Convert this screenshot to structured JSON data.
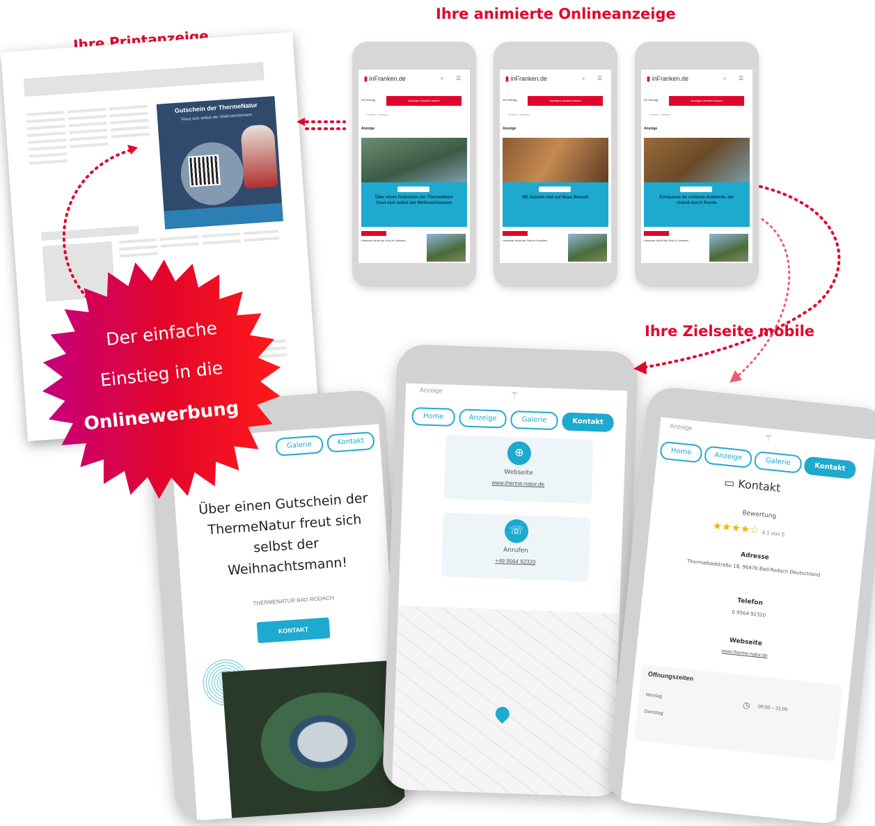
{
  "headings": {
    "print": "Ihre Printanzeige",
    "online": "Ihre animierte Onlineanzeige",
    "target": "Ihre Zielseite mobile"
  },
  "burst": {
    "line1": "Der einfache",
    "line2": "Einstieg in die",
    "line3": "Onlinewerbung"
  },
  "print_ad": {
    "title": "Gutschein der ThermeNatur",
    "subtitle": "Freut sich selbst der Weihnachtsmann"
  },
  "small_phone": {
    "logo": "inFranken",
    "logo_suffix": ".de",
    "anzeige": "Anzeige",
    "red_button": "Anzeigen schalten lassen",
    "tag": "28 Feiertag",
    "crumb": "Photos  ›  Sitemap",
    "news_text": "Hirschwe-Wuld mit Geld in Schutten",
    "ads": [
      {
        "text": "Über einen Gutschein der ThermeNatur freut sich selbst der Weihnachtsmann"
      },
      {
        "text": "Mit Saunen und auf Maas Besuch"
      },
      {
        "text": "Entspanne im schönen Ambiente, der eiskalt durch Runde"
      }
    ]
  },
  "left_phone": {
    "nav": [
      "Galerie",
      "Kontakt"
    ],
    "headline": "Über einen Gutschein der ThermeNatur freut sich selbst der Weihnachtsmann!",
    "subline": "THERMENATUR BAD RODACH",
    "button": "KONTAKT"
  },
  "middle_phone": {
    "anzeige": "Anzeige",
    "nav": [
      "Home",
      "Anzeige",
      "Galerie",
      "Kontakt"
    ],
    "website_label": "Webseite",
    "website_url": "www.therme-natur.de",
    "call_label": "Anrufen",
    "call_number": "+49 9564 92320"
  },
  "right_phone": {
    "anzeige": "Anzeige",
    "nav": [
      "Home",
      "Anzeige",
      "Galerie",
      "Kontakt"
    ],
    "title": "Kontakt",
    "rating_label": "Bewertung",
    "rating_value": "4.1 von 5",
    "address_label": "Adresse",
    "address": "Thermalbadstraße 18, 96476 Bad Rodach Deutschland",
    "phone_label": "Telefon",
    "phone": "0 9564 92320",
    "web_label": "Webseite",
    "web": "www.therme-natur.de",
    "hours_label": "Öffnungszeiten",
    "day1": "Montag",
    "day2": "Dienstag",
    "hours": "09:00 – 21:00"
  },
  "colors": {
    "accent_red": "#e2052b",
    "accent_blue": "#1ea9cf"
  }
}
